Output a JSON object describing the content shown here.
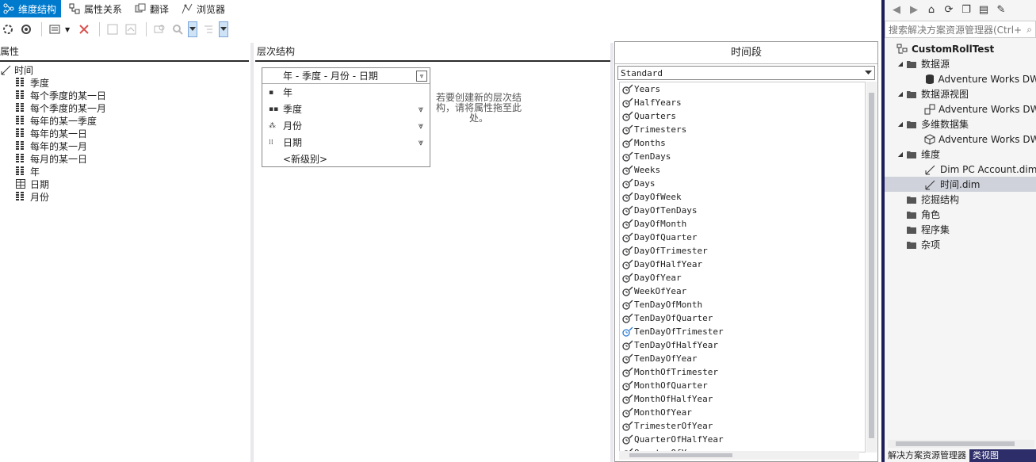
{
  "designer_tabs": [
    {
      "label": "维度结构",
      "icon": "dimension-structure-icon",
      "active": true
    },
    {
      "label": "属性关系",
      "icon": "attribute-relationships-icon",
      "active": false
    },
    {
      "label": "翻译",
      "icon": "translations-icon",
      "active": false
    },
    {
      "label": "浏览器",
      "icon": "browser-icon",
      "active": false
    }
  ],
  "attributes_pane": {
    "header": "属性",
    "root": "时间",
    "items": [
      "季度",
      "每个季度的某一日",
      "每个季度的某一月",
      "每年的某一季度",
      "每年的某一日",
      "每年的某一月",
      "每月的某一日",
      "年",
      "日期",
      "月份"
    ]
  },
  "hierarchies_pane": {
    "header": "层次结构",
    "hierarchy_title": "年 - 季度 - 月份 - 日期",
    "levels": [
      "年",
      "季度",
      "月份",
      "日期"
    ],
    "new_level": "<新级别>",
    "hint": "若要创建新的层次结构，请将属性拖至此处。"
  },
  "time_period_pane": {
    "header": "时间段",
    "selected_calendar": "Standard",
    "items": [
      "Years",
      "HalfYears",
      "Quarters",
      "Trimesters",
      "Months",
      "TenDays",
      "Weeks",
      "Days",
      "DayOfWeek",
      "DayOfTenDays",
      "DayOfMonth",
      "DayOfQuarter",
      "DayOfTrimester",
      "DayOfHalfYear",
      "DayOfYear",
      "WeekOfYear",
      "TenDayOfMonth",
      "TenDayOfQuarter",
      "TenDayOfTrimester",
      "TenDayOfHalfYear",
      "TenDayOfYear",
      "MonthOfTrimester",
      "MonthOfQuarter",
      "MonthOfHalfYear",
      "MonthOfYear",
      "TrimesterOfYear",
      "QuarterOfHalfYear",
      "QuarterOfYear"
    ],
    "highlighted_item": "TenDayOfTrimester"
  },
  "solution_explorer": {
    "search_placeholder": "搜索解决方案资源管理器(Ctrl+",
    "project": "CustomRollTest",
    "folders": {
      "data_sources": {
        "label": "数据源",
        "child": "Adventure Works DW"
      },
      "dsv": {
        "label": "数据源视图",
        "child": "Adventure Works DW"
      },
      "cubes": {
        "label": "多维数据集",
        "child": "Adventure Works DW"
      },
      "dimensions": {
        "label": "维度",
        "children": [
          "Dim PC Account.dim",
          "时间.dim"
        ]
      },
      "mining": {
        "label": "挖掘结构"
      },
      "roles": {
        "label": "角色"
      },
      "assemblies": {
        "label": "程序集"
      },
      "misc": {
        "label": "杂项"
      }
    },
    "bottom_tabs": [
      "解决方案资源管理器",
      "类视图"
    ]
  },
  "colors": {
    "accent": "#007acc",
    "selection": "#cfd2db",
    "frame": "#1e1e5a"
  }
}
